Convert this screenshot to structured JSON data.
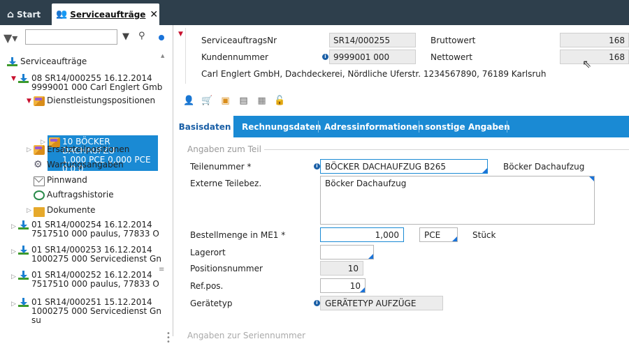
{
  "tabs": [
    {
      "label": "Start",
      "icon": "home-icon"
    },
    {
      "label": "Serviceaufträge",
      "icon": "service-users-icon",
      "close": "✕"
    }
  ],
  "left": {
    "filter_value": "",
    "tree": {
      "root": "Serviceaufträge",
      "order1": {
        "line1": "08 SR14/000255 16.12.2014",
        "line2": "9999001 000 Carl Englert Gmb"
      },
      "group_service": "Dienstleistungspositionen",
      "selected": {
        "line1": "10 BÖCKER DACHAUFZU",
        "line2": "1,000 PCE 0,000 PCE",
        "line3": "0 0 0"
      },
      "group_parts": "Ersatzteilpositionen",
      "maintenance": "Wartungsangaben",
      "pinboard": "Pinnwand",
      "history": "Auftragshistorie",
      "documents": "Dokumente",
      "orders": [
        {
          "line1": "01 SR14/000254 16.12.2014",
          "line2": "7517510 000 paulus, 77833 O"
        },
        {
          "line1": "01 SR14/000253 16.12.2014",
          "line2": "1000275 000 Servicedienst Gn"
        },
        {
          "line1": "01 SR14/000252 16.12.2014",
          "line2": "7517510 000 paulus, 77833 O"
        },
        {
          "line1": "01 SR14/000251 15.12.2014",
          "line2": "1000275 000 Servicedienst Gn",
          "line3": "su"
        }
      ]
    }
  },
  "header": {
    "order_no_label": "ServiceauftragsNr",
    "order_no_value": "SR14/000255",
    "customer_no_label": "Kundennummer",
    "customer_no_value": "9999001 000",
    "gross_label": "Bruttowert",
    "gross_value": "168",
    "net_label": "Nettowert",
    "net_value": "168",
    "customer_line": "Carl Englert GmbH, Dachdeckerei, Nördliche Uferstr. 1234567890, 76189 Karlsruh"
  },
  "content_tabs": [
    "Basisdaten",
    "Rechnungsdaten",
    "Adressinformationen",
    "sonstige Angaben"
  ],
  "form": {
    "section_title": "Angaben zum Teil",
    "part_no_label": "Teilenummer *",
    "part_no_value": "BÖCKER DACHAUFZUG B265",
    "part_no_desc": "Böcker Dachaufzug",
    "ext_desc_label": "Externe Teilebez.",
    "ext_desc_value": "Böcker Dachaufzug",
    "qty_label": "Bestellmenge in ME1 *",
    "qty_value": "1,000",
    "unit_value": "PCE",
    "unit_desc": "Stück",
    "storage_label": "Lagerort",
    "storage_value": "",
    "pos_no_label": "Positionsnummer",
    "pos_no_value": "10",
    "ref_pos_label": "Ref.pos.",
    "ref_pos_value": "10",
    "device_type_label": "Gerätetyp",
    "device_type_value": "GERÄTETYP AUFZÜGE",
    "next_section_title": "Angaben zur Seriennummer"
  },
  "colors": {
    "accent": "#1a8ad4",
    "topbar": "#2e3f4c",
    "selected": "#1a8ad4"
  }
}
